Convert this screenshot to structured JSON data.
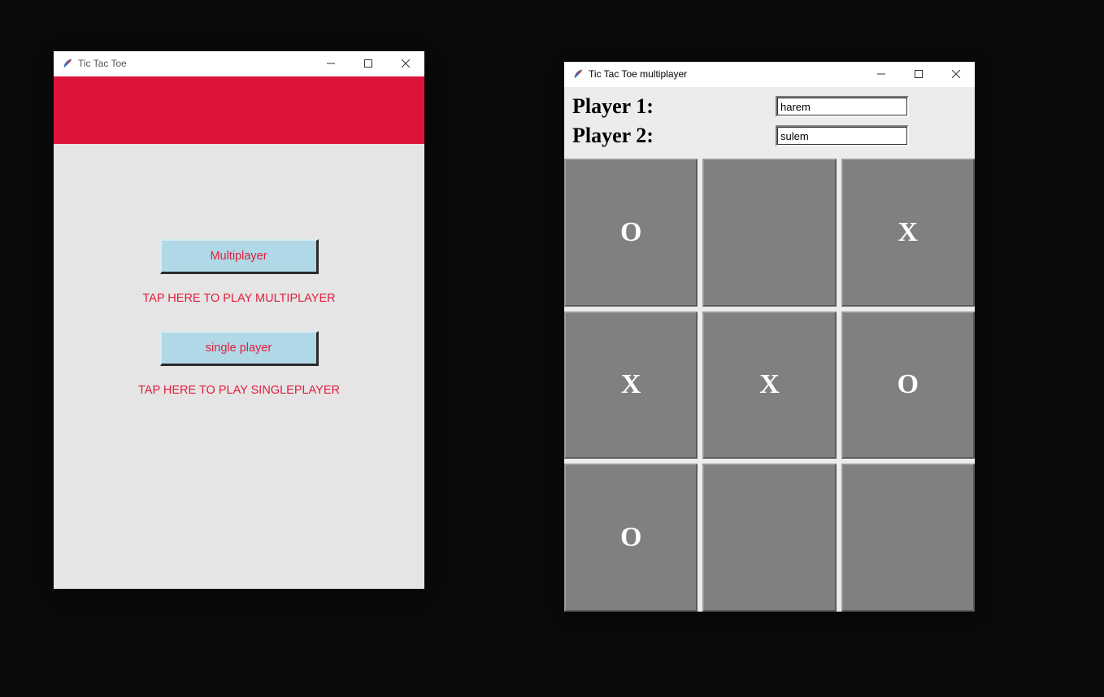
{
  "window1": {
    "title": "Tic Tac Toe",
    "buttons": {
      "multiplayer_label": "Multiplayer",
      "multiplayer_hint": "TAP HERE TO PLAY MULTIPLAYER",
      "singleplayer_label": "single player",
      "singleplayer_hint": "TAP HERE TO PLAY SINGLEPLAYER"
    }
  },
  "window2": {
    "title": "Tic Tac Toe multiplayer",
    "player1_label": "Player 1:",
    "player2_label": "Player 2:",
    "player1_value": "harem",
    "player2_value": "sulem",
    "board": {
      "r0c0": "O",
      "r0c1": "",
      "r0c2": "X",
      "r1c0": "X",
      "r1c1": "X",
      "r1c2": "O",
      "r2c0": "O",
      "r2c1": "",
      "r2c2": ""
    }
  },
  "colors": {
    "accent_red": "#dc143c",
    "button_bg": "#b0d8e6",
    "cell_bg": "#808080"
  }
}
